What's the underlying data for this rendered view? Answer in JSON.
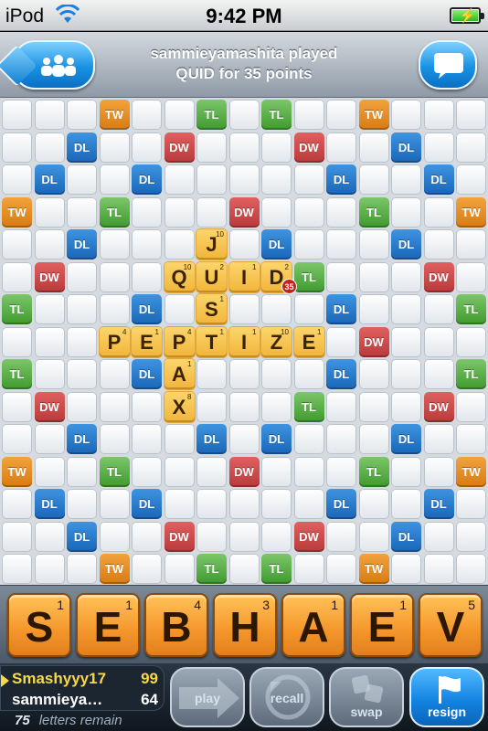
{
  "status_bar": {
    "carrier": "iPod",
    "time": "9:42 PM"
  },
  "header": {
    "message_line1": "sammieyamashita played",
    "message_line2": "QUID for 35 points",
    "friends_icon": "people-icon",
    "chat_icon": "chat-bubble-icon"
  },
  "board": {
    "premium_legend": {
      "TW": "TW",
      "DW": "DW",
      "TL": "TL",
      "DL": "DL"
    },
    "colors": {
      "TW": "#e38a22",
      "DW": "#cc4a4a",
      "TL": "#5aae45",
      "DL": "#2a7ccc",
      "tile": "#f5c04c"
    },
    "premiums": [
      [
        "",
        "",
        "",
        "TW",
        "",
        "",
        "TL",
        "",
        "TL",
        "",
        "",
        "TW",
        "",
        "",
        ""
      ],
      [
        "",
        "",
        "DL",
        "",
        "",
        "DW",
        "",
        "",
        "",
        "DW",
        "",
        "",
        "DL",
        "",
        ""
      ],
      [
        "",
        "DL",
        "",
        "",
        "DL",
        "",
        "",
        "",
        "",
        "",
        "DL",
        "",
        "",
        "DL",
        ""
      ],
      [
        "TW",
        "",
        "",
        "TL",
        "",
        "",
        "",
        "DW",
        "",
        "",
        "",
        "TL",
        "",
        "",
        "TW"
      ],
      [
        "",
        "",
        "DL",
        "",
        "",
        "",
        "DL",
        "",
        "DL",
        "",
        "",
        "",
        "DL",
        "",
        ""
      ],
      [
        "",
        "DW",
        "",
        "",
        "",
        "TL",
        "",
        "",
        "",
        "TL",
        "",
        "",
        "",
        "DW",
        ""
      ],
      [
        "TL",
        "",
        "",
        "",
        "DL",
        "",
        "",
        "",
        "",
        "",
        "DL",
        "",
        "",
        "",
        "TL"
      ],
      [
        "",
        "",
        "",
        "",
        "",
        "",
        "",
        "",
        "",
        "",
        "",
        "DW",
        "",
        "",
        ""
      ],
      [
        "TL",
        "",
        "",
        "",
        "DL",
        "",
        "",
        "",
        "",
        "",
        "DL",
        "",
        "",
        "",
        "TL"
      ],
      [
        "",
        "DW",
        "",
        "",
        "",
        "TL",
        "",
        "",
        "",
        "TL",
        "",
        "",
        "",
        "DW",
        ""
      ],
      [
        "",
        "",
        "DL",
        "",
        "",
        "",
        "DL",
        "",
        "DL",
        "",
        "",
        "",
        "DL",
        "",
        ""
      ],
      [
        "TW",
        "",
        "",
        "TL",
        "",
        "",
        "",
        "DW",
        "",
        "",
        "",
        "TL",
        "",
        "",
        "TW"
      ],
      [
        "",
        "DL",
        "",
        "",
        "DL",
        "",
        "",
        "",
        "",
        "",
        "DL",
        "",
        "",
        "DL",
        ""
      ],
      [
        "",
        "",
        "DL",
        "",
        "",
        "DW",
        "",
        "",
        "",
        "DW",
        "",
        "",
        "DL",
        "",
        ""
      ],
      [
        "",
        "",
        "",
        "TW",
        "",
        "",
        "TL",
        "",
        "TL",
        "",
        "",
        "TW",
        "",
        "",
        ""
      ]
    ],
    "tiles": [
      {
        "row": 4,
        "col": 6,
        "letter": "J",
        "points": "10"
      },
      {
        "row": 5,
        "col": 5,
        "letter": "Q",
        "points": "10"
      },
      {
        "row": 5,
        "col": 6,
        "letter": "U",
        "points": "2"
      },
      {
        "row": 5,
        "col": 7,
        "letter": "I",
        "points": "1"
      },
      {
        "row": 5,
        "col": 8,
        "letter": "D",
        "points": "2"
      },
      {
        "row": 6,
        "col": 6,
        "letter": "S",
        "points": "1"
      },
      {
        "row": 7,
        "col": 3,
        "letter": "P",
        "points": "4"
      },
      {
        "row": 7,
        "col": 4,
        "letter": "E",
        "points": "1"
      },
      {
        "row": 7,
        "col": 5,
        "letter": "P",
        "points": "4"
      },
      {
        "row": 7,
        "col": 6,
        "letter": "T",
        "points": "1"
      },
      {
        "row": 7,
        "col": 7,
        "letter": "I",
        "points": "1"
      },
      {
        "row": 7,
        "col": 8,
        "letter": "Z",
        "points": "10"
      },
      {
        "row": 7,
        "col": 9,
        "letter": "E",
        "points": "1"
      },
      {
        "row": 8,
        "col": 5,
        "letter": "A",
        "points": "1"
      },
      {
        "row": 9,
        "col": 5,
        "letter": "X",
        "points": "8"
      }
    ],
    "last_play_score": "35"
  },
  "rack": {
    "tiles": [
      {
        "letter": "S",
        "points": "1"
      },
      {
        "letter": "E",
        "points": "1"
      },
      {
        "letter": "B",
        "points": "4"
      },
      {
        "letter": "H",
        "points": "3"
      },
      {
        "letter": "A",
        "points": "1"
      },
      {
        "letter": "E",
        "points": "1"
      },
      {
        "letter": "V",
        "points": "5"
      }
    ]
  },
  "scores": {
    "player1": {
      "name": "Smashyyy17",
      "score": "99"
    },
    "player2": {
      "name": "sammieya…",
      "score": "64"
    }
  },
  "letters_remain": {
    "count": "75",
    "label": "letters remain"
  },
  "actions": {
    "play": "play",
    "recall": "recall",
    "swap": "swap",
    "resign": "resign"
  }
}
